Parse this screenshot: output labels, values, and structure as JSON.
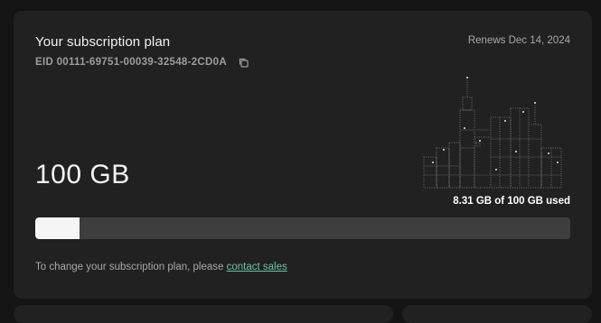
{
  "plan": {
    "title": "Your subscription plan",
    "eid": "EID 00111-69751-00039-32548-2CD0A",
    "renews": "Renews Dec 14, 2024",
    "capacity": "100 GB",
    "usage_label": "8.31 GB of 100 GB used",
    "usage_fraction": 0.0831,
    "footer_text": "To change your subscription plan, please ",
    "footer_link": "contact sales"
  },
  "icons": {
    "copy": "copy-icon",
    "illustration": "city-skyline-illustration"
  },
  "colors": {
    "background": "#141414",
    "card": "#212121",
    "bar_track": "#3e3e3e",
    "bar_fill": "#f5f5f5",
    "link": "#6fc0a3"
  }
}
